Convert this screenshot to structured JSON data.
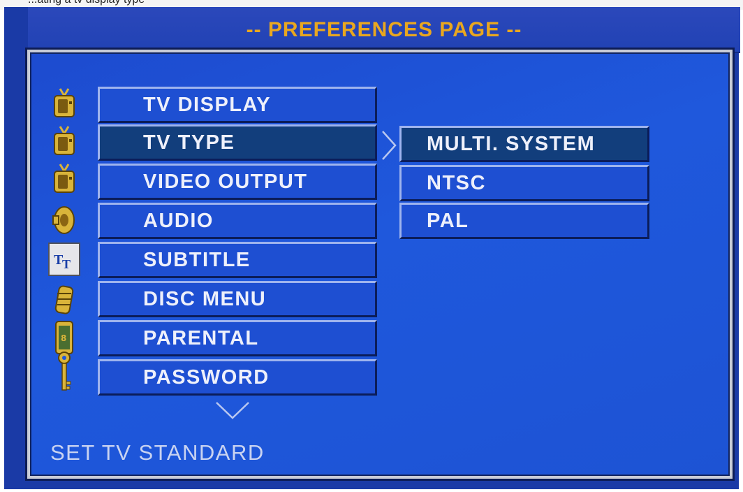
{
  "top_strip": {
    "text": "...ating a tv display type"
  },
  "header": {
    "title": "-- PREFERENCES PAGE --"
  },
  "side_icons": [
    {
      "name": "tv-icon"
    },
    {
      "name": "tv-icon"
    },
    {
      "name": "tv-icon"
    },
    {
      "name": "speaker-icon"
    },
    {
      "name": "subtitle-icon"
    },
    {
      "name": "disc-menu-icon"
    },
    {
      "name": "parental-icon"
    },
    {
      "name": "key-icon"
    }
  ],
  "menu": {
    "items": [
      {
        "label": "TV DISPLAY"
      },
      {
        "label": "TV TYPE"
      },
      {
        "label": "VIDEO OUTPUT"
      },
      {
        "label": "AUDIO"
      },
      {
        "label": "SUBTITLE"
      },
      {
        "label": "DISC MENU"
      },
      {
        "label": "PARENTAL"
      },
      {
        "label": "PASSWORD"
      }
    ],
    "selected": "TV TYPE"
  },
  "options": {
    "items": [
      {
        "label": "MULTI. SYSTEM"
      },
      {
        "label": "NTSC"
      },
      {
        "label": "PAL"
      }
    ],
    "selected": "MULTI. SYSTEM"
  },
  "status": {
    "text": "SET TV STANDARD"
  },
  "colors": {
    "background": "#1f58dc",
    "title": "#e9a71f",
    "selected_item": "#123e7c",
    "text": "#eef0fb"
  }
}
